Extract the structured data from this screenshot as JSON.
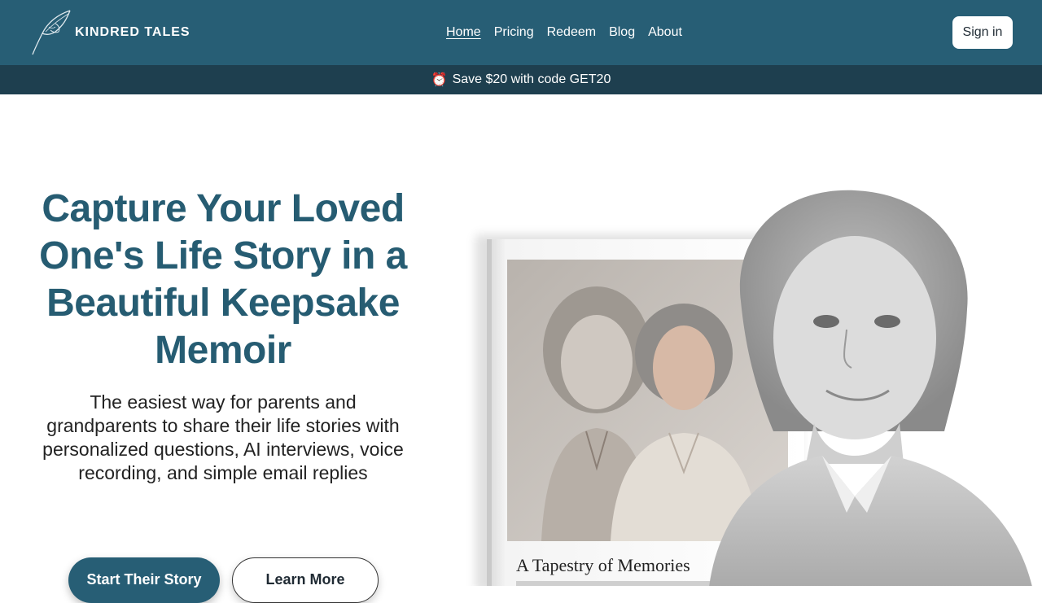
{
  "brand": {
    "name": "KINDRED TALES",
    "logo_icon": "quill-icon"
  },
  "nav": {
    "links": [
      {
        "label": "Home",
        "active": true
      },
      {
        "label": "Pricing",
        "active": false
      },
      {
        "label": "Redeem",
        "active": false
      },
      {
        "label": "Blog",
        "active": false
      },
      {
        "label": "About",
        "active": false
      }
    ],
    "signin_label": "Sign in"
  },
  "promo": {
    "icon": "alarm-clock-icon",
    "icon_glyph": "⏰",
    "text": "Save $20 with code GET20"
  },
  "hero": {
    "title": "Capture Your Loved One's Life Story in a Beautiful Keepsake Memoir",
    "subtitle": "The easiest way for parents and grandparents to share their life stories with personalized questions, AI interviews, voice recording, and simple email replies",
    "primary_cta": "Start Their Story",
    "secondary_cta": "Learn More"
  },
  "book": {
    "title": "A Tapestry of Memories"
  },
  "colors": {
    "brand": "#275e75",
    "promo_bg": "#1e3f4f",
    "title": "#265c72"
  }
}
